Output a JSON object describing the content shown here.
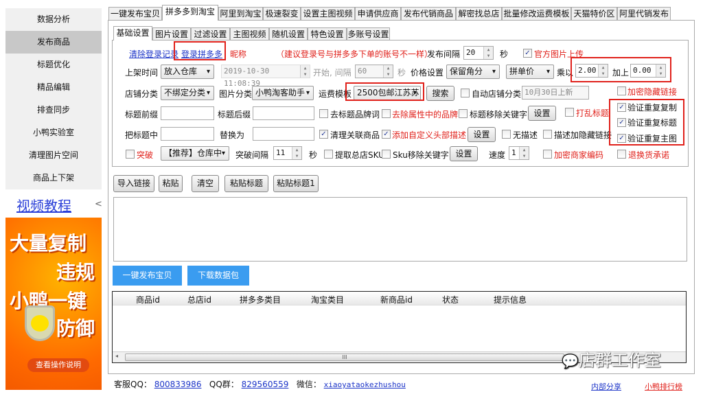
{
  "sidebar": {
    "items": [
      "数据分析",
      "发布商品",
      "标题优化",
      "精品编辑",
      "排查同步",
      "小鸭实验室",
      "清理图片空间",
      "商品上下架"
    ],
    "selected": "发布商品",
    "video_link": "视频教程",
    "collapse": "<"
  },
  "banner": {
    "line1": "大量复制",
    "line2": "违规",
    "line3": "小鸭一键",
    "line4": "防御",
    "button": "查看操作说明"
  },
  "top_tabs": [
    "一键发布宝贝",
    "拼多多到淘宝",
    "阿里到淘宝",
    "极速裂变",
    "设置主图视频",
    "申请供应商",
    "发布代销商品",
    "解密找总店",
    "批量修改运费模板",
    "天猫特价区",
    "阿里代销发布"
  ],
  "inner_tabs": [
    "基础设置",
    "图片设置",
    "过滤设置",
    "主图视频",
    "随机设置",
    "特色设置",
    "多账号设置"
  ],
  "row1": {
    "clear_login": "清除登录记录",
    "login_pdd": "登录拼多多",
    "nickname": "昵称",
    "hint": "（建议登录号与拼多多下单的账号不一样）",
    "interval_label": "发布间隔",
    "interval_value": "20",
    "sec": "秒",
    "official_img": "官方图片上传"
  },
  "row2": {
    "list_time_label": "上架时间",
    "list_time_value": "放入仓库",
    "datetime": "2019-10-30 11:08:39",
    "start_interval": "开始, 间隔",
    "interval_value": "60",
    "sec": "秒",
    "price_label": "价格设置",
    "price_mode": "保留角分",
    "price_base": "拼单价",
    "multiply_label": "乘以",
    "multiply_value": "2.00",
    "add_label": "加上",
    "add_value": "0.00"
  },
  "row3": {
    "shop_cat_label": "店铺分类",
    "shop_cat_value": "不绑定分类",
    "img_cat_label": "图片分类",
    "img_cat_value": "小鸭淘客助手",
    "freight_label": "运费模板",
    "freight_value": "2500包邮江苏苏",
    "search": "搜索",
    "auto_cat": "自动店铺分类",
    "auto_cat_value": "10月30日上新",
    "encrypt_link": "加密隐藏链接"
  },
  "row4": {
    "prefix_label": "标题前缀",
    "suffix_label": "标题后缀",
    "remove_brand_title": "去标题品牌词",
    "remove_brand_attr": "去除属性中的品牌",
    "title_remove_kw": "标题移除关键字",
    "settings": "设置",
    "shuffle_title": "打乱标题",
    "verify_copy": "验证重复复制"
  },
  "row5": {
    "replace_from_label": "把标题中",
    "replace_to_label": "替换为",
    "clean_related": "清理关联商品",
    "custom_header": "添加自定义头部描述",
    "settings": "设置",
    "no_desc": "无描述",
    "desc_hidden_link": "描述加隐藏链接",
    "verify_title": "验证重复标题",
    "verify_main_img": "验证重复主图"
  },
  "row6": {
    "breakthrough": "突破",
    "bt_mode": "【推荐】仓库中",
    "bt_interval_label": "突破间隔",
    "bt_interval_value": "11",
    "sec": "秒",
    "extract_sku": "提取总店SKU",
    "sku_remove_kw": "Sku移除关键字",
    "settings": "设置",
    "speed_label": "速度",
    "speed_value": "1",
    "encrypt_code": "加密商家编码",
    "return_promise": "退换货承诺"
  },
  "actions": [
    "导入链接",
    "粘贴",
    "清空",
    "粘贴标题",
    "粘贴标题1"
  ],
  "blue_buttons": [
    "一键发布宝贝",
    "下载数据包"
  ],
  "table": {
    "columns": [
      "商品id",
      "总店id",
      "拼多多类目",
      "淘宝类目",
      "新商品id",
      "状态",
      "提示信息"
    ],
    "rows": [],
    "scroll_grip": "III"
  },
  "footer": {
    "qq_label": "客服QQ：",
    "qq": "800833986",
    "group_label": "QQ群：",
    "group": "829560559",
    "wechat_label": "微信：",
    "wechat": "xiaoyataokezhushou",
    "internal_share": "内部分享",
    "ranking": "小鸭排行榜"
  },
  "watermark": "店群工作室",
  "colors": {
    "accent_blue": "#3a9cf0",
    "highlight_red": "#e0201a",
    "link_blue": "#1d35c8"
  }
}
